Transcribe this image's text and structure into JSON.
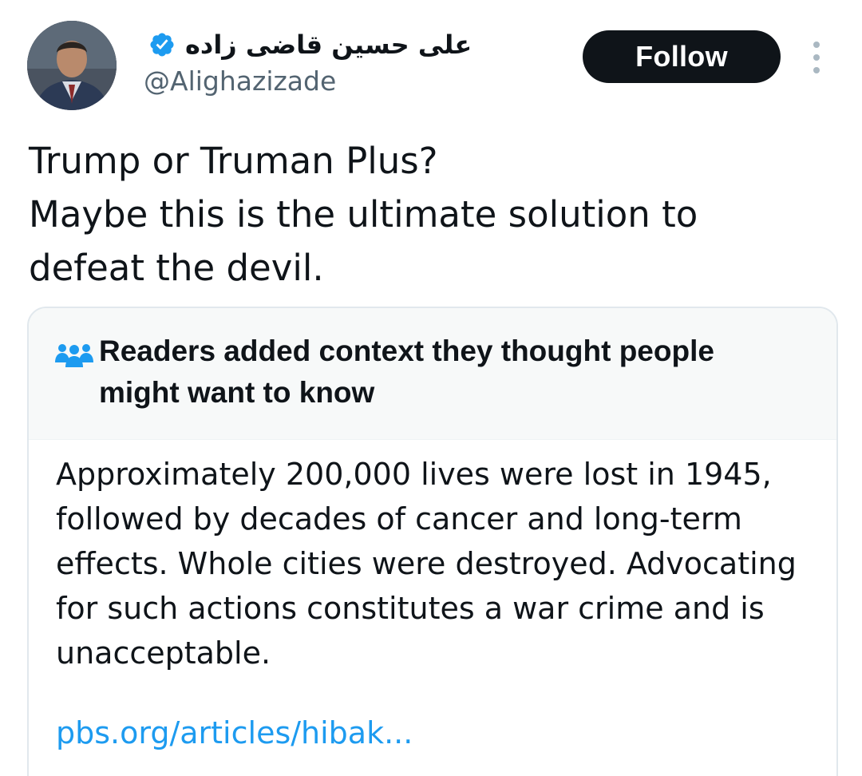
{
  "user": {
    "display_name": "علی حسین قاضی زاده",
    "handle": "@Alighazizade",
    "verified": true,
    "verified_color": "#1d9bf0"
  },
  "actions": {
    "follow_label": "Follow",
    "more_icon": "more-vertical-icon"
  },
  "tweet": {
    "lines": [
      "Trump or Truman Plus?",
      "Maybe this is the ultimate solution to",
      "defeat the devil."
    ]
  },
  "community_note": {
    "icon": "people-icon",
    "title": "Readers added context they thought people might want to know",
    "body_lines": [
      "Approximately 200,000 lives were lost in 1945,",
      "followed by decades of cancer and long-term",
      "effects. Whole cities were destroyed. Advocating",
      "for such actions constitutes a war crime and is",
      "unacceptable."
    ],
    "link_text": "pbs.org/articles/hibak...",
    "link_color": "#1d9bf0"
  }
}
